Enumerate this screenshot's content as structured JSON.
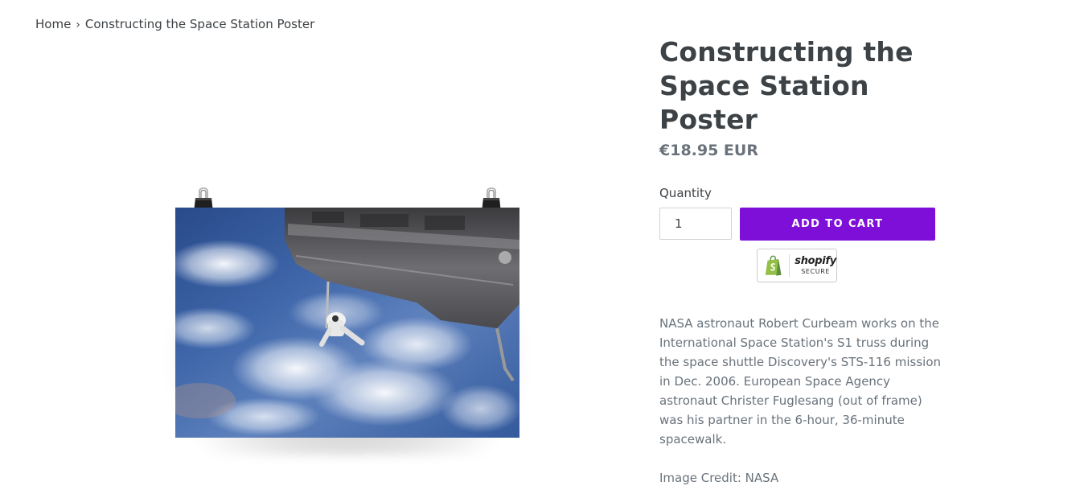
{
  "breadcrumb": {
    "home": "Home",
    "separator": "›",
    "current": "Constructing the Space Station Poster"
  },
  "product": {
    "title": "Constructing the Space Station Poster",
    "price": "€18.95 EUR",
    "quantity_label": "Quantity",
    "quantity_value": "1",
    "add_to_cart": "ADD TO CART",
    "badge": {
      "brand": "shopify",
      "secure": "SECURE",
      "icon": "shopify-bag-icon"
    },
    "description": "NASA astronaut Robert Curbeam works on the International Space Station's S1 truss during the space shuttle Discovery's STS-116 mission in Dec. 2006. European Space Agency astronaut Christer Fuglesang (out of frame) was his partner in the 6-hour, 36-minute spacewalk.",
    "credit": "Image Credit: NASA"
  },
  "colors": {
    "accent": "#7d0fd8",
    "text": "#3d4246",
    "muted": "#69727b"
  }
}
